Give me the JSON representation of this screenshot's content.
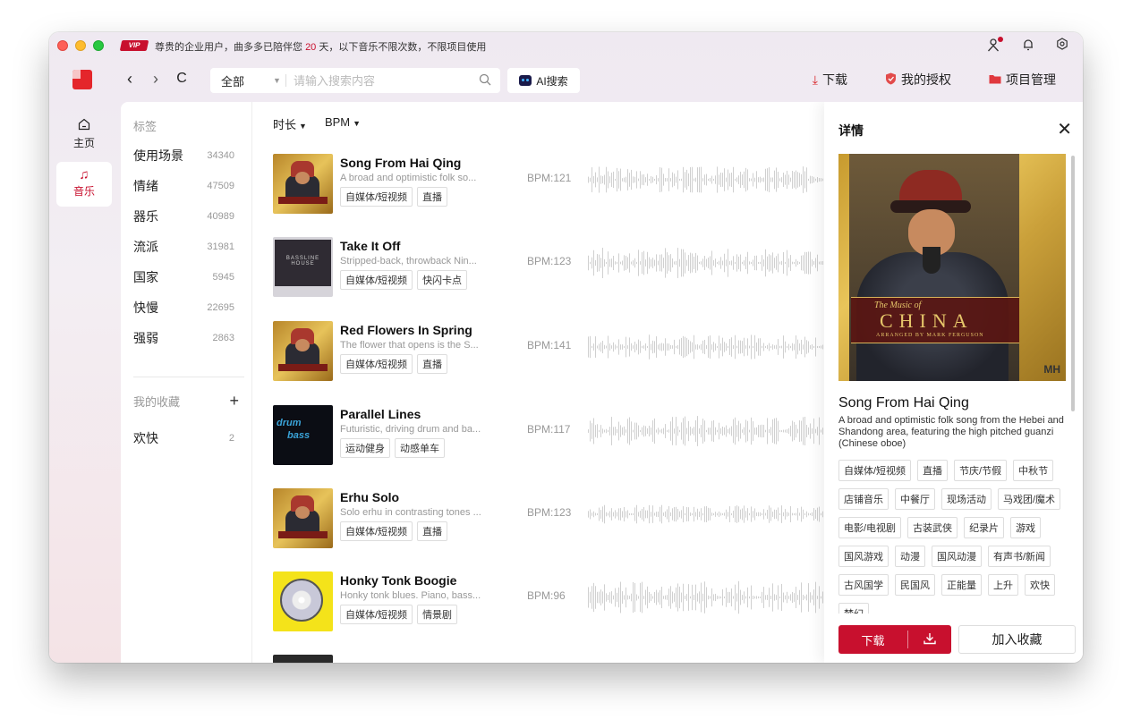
{
  "titlebar": {
    "notice_prefix": "尊贵的企业用户，曲多多已陪伴您",
    "notice_days": "20",
    "notice_suffix": "天，以下音乐不限次数，不限项目使用"
  },
  "toolbar": {
    "search_category": "全部",
    "search_placeholder": "请输入搜索内容",
    "ai_search_label": "AI搜索",
    "actions": [
      {
        "label": "下载",
        "icon": "download-icon"
      },
      {
        "label": "我的授权",
        "icon": "shield-icon"
      },
      {
        "label": "项目管理",
        "icon": "folder-icon"
      }
    ]
  },
  "rail": {
    "home_label": "主页",
    "music_label": "音乐"
  },
  "tags": {
    "header": "标签",
    "items": [
      {
        "label": "使用场景",
        "count": "34340"
      },
      {
        "label": "情绪",
        "count": "47509"
      },
      {
        "label": "器乐",
        "count": "40989"
      },
      {
        "label": "流派",
        "count": "31981"
      },
      {
        "label": "国家",
        "count": "5945"
      },
      {
        "label": "快慢",
        "count": "22695"
      },
      {
        "label": "强弱",
        "count": "2863"
      }
    ],
    "favorites_header": "我的收藏",
    "favorites": [
      {
        "label": "欢快",
        "count": "2"
      }
    ]
  },
  "filters": [
    {
      "label": "时长"
    },
    {
      "label": "BPM"
    }
  ],
  "songs": [
    {
      "title": "Song From Hai Qing",
      "desc": "A broad and optimistic folk so...",
      "tags": [
        "自媒体/短视频",
        "直播"
      ],
      "bpm": "BPM:121",
      "cover": "china"
    },
    {
      "title": "Take It Off",
      "desc": "Stripped-back, throwback Nin...",
      "tags": [
        "自媒体/短视频",
        "快闪卡点"
      ],
      "bpm": "BPM:123",
      "cover": "bassline"
    },
    {
      "title": "Red Flowers In Spring",
      "desc": "The flower that opens is the S...",
      "tags": [
        "自媒体/短视频",
        "直播"
      ],
      "bpm": "BPM:141",
      "cover": "china"
    },
    {
      "title": "Parallel Lines",
      "desc": "Futuristic, driving drum and ba...",
      "tags": [
        "运动健身",
        "动感单车"
      ],
      "bpm": "BPM:117",
      "cover": "drum"
    },
    {
      "title": "Erhu Solo",
      "desc": "Solo erhu in contrasting tones ...",
      "tags": [
        "自媒体/短视频",
        "直播"
      ],
      "bpm": "BPM:123",
      "cover": "china"
    },
    {
      "title": "Honky Tonk Boogie",
      "desc": "Honky tonk blues. Piano, bass...",
      "tags": [
        "自媒体/短视频",
        "情景剧"
      ],
      "bpm": "BPM:96",
      "cover": "honky"
    }
  ],
  "covers": {
    "bassline_text": "BASSLINE HOUSE",
    "drum_text_1": "drum",
    "drum_text_2": "bass"
  },
  "detail": {
    "header": "详情",
    "art_the": "The Music of",
    "art_china": "CHINA",
    "art_sub": "ARRANGED BY MARK FERGUSON",
    "art_mh": "MH",
    "title": "Song From Hai Qing",
    "description": "A broad and optimistic folk song from the Hebei and Shandong area, featuring the high pitched guanzi (Chinese oboe)",
    "tags": [
      "自媒体/短视频",
      "直播",
      "节庆/节假",
      "中秋节",
      "店铺音乐",
      "中餐厅",
      "现场活动",
      "马戏团/魔术",
      "电影/电视剧",
      "古装武侠",
      "纪录片",
      "游戏",
      "国风游戏",
      "动漫",
      "国风动漫",
      "有声书/新闻",
      "古风国学",
      "民国风",
      "正能量",
      "上升",
      "欢快",
      "梦幻"
    ],
    "download_label": "下载",
    "favorite_label": "加入收藏"
  }
}
